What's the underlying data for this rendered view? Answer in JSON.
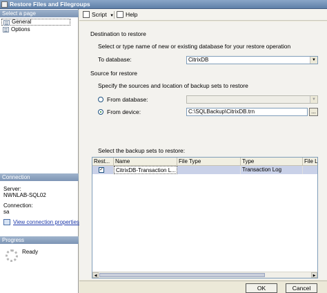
{
  "window": {
    "title": "Restore Files and Filegroups"
  },
  "left_panel": {
    "select_page_header": "Select a page",
    "pages": [
      {
        "label": "General",
        "selected": true
      },
      {
        "label": "Options",
        "selected": false
      }
    ],
    "connection_header": "Connection",
    "server_label": "Server:",
    "server_value": "NWNLAB-SQL02",
    "connection_label": "Connection:",
    "connection_value": "sa",
    "view_connection_link": "View connection properties",
    "progress_header": "Progress",
    "progress_status": "Ready"
  },
  "toolbar": {
    "script_label": "Script",
    "help_label": "Help"
  },
  "form": {
    "destination_header": "Destination to restore",
    "destination_desc": "Select or type name of new or existing database for your restore operation",
    "to_database_label": "To database:",
    "to_database_value": "CitrixDB",
    "source_header": "Source for restore",
    "source_desc": "Specify the sources and location of backup sets to restore",
    "from_database_label": "From database:",
    "from_database_value": "",
    "from_device_label": "From device:",
    "from_device_value": "C:\\SQLBackup\\CitrixDB.trn",
    "browse_label": "...",
    "selected_source": "From device",
    "backup_sets_label": "Select the backup sets to restore:"
  },
  "backup_table": {
    "columns": [
      "Rest...",
      "Name",
      "File Type",
      "Type",
      "File Lo"
    ],
    "rows": [
      {
        "restore": true,
        "name": "CitrixDB-Transaction L...",
        "file_type": "",
        "type": "Transaction Log",
        "file_location": ""
      }
    ]
  },
  "buttons": {
    "ok": "OK",
    "cancel": "Cancel"
  }
}
